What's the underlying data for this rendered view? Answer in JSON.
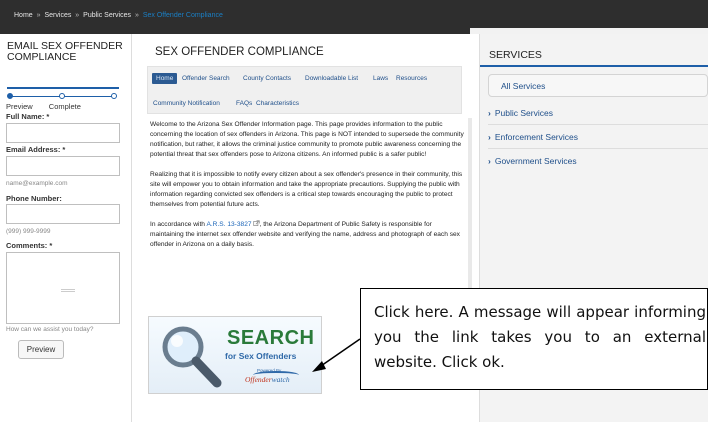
{
  "breadcrumb": {
    "items": [
      "Home",
      "Services",
      "Public Services"
    ],
    "separator": "»",
    "current": "Sex Offender Compliance"
  },
  "left_form": {
    "title": "EMAIL SEX OFFENDER COMPLIANCE",
    "steps": [
      "Preview",
      "Complete"
    ],
    "full_name_label": "Full Name: *",
    "email_label": "Email Address: *",
    "email_hint": "name@example.com",
    "phone_label": "Phone Number:",
    "phone_hint": "(999) 999-9999",
    "comments_label": "Comments: *",
    "comments_hint": "How can we assist you today?",
    "preview_button": "Preview"
  },
  "main": {
    "title": "SEX OFFENDER COMPLIANCE",
    "tabs": [
      "Home",
      "Offender Search",
      "County Contacts",
      "Downloadable List",
      "Laws",
      "Resources",
      "Community Notification",
      "FAQs",
      "Characteristics"
    ],
    "paragraph1": "Welcome to the Arizona Sex Offender Information page. This page provides information to the public concerning the location of sex offenders in Arizona. This page is NOT intended to supersede the community notification, but rather, it allows the criminal justice community to promote public awareness concerning the potential threat that sex offenders pose to Arizona citizens. An informed public is a safer public!",
    "paragraph2": "Realizing that it is impossible to notify every citizen about a sex offender's presence in their community, this site will empower you to obtain information and take the appropriate precautions. Supplying the public with information regarding convicted sex offenders is a critical step towards encouraging the public to protect themselves from potential future acts.",
    "paragraph3_before": "In accordance with ",
    "paragraph3_link": "A.R.S. 13-3827",
    "paragraph3_after": ", the Arizona Department of Public Safety is responsible for maintaining the internet sex offender website and verifying the name, address and photograph of each sex offender in Arizona on a daily basis.",
    "search_image": {
      "word": "SEARCH",
      "subtitle": "for Sex Offenders",
      "powered": "Powered By",
      "brand_a": "Offender",
      "brand_b": "watch"
    }
  },
  "services": {
    "title": "SERVICES",
    "all": "All Services",
    "items": [
      "Public Services",
      "Enforcement Services",
      "Government Services"
    ]
  },
  "callout": {
    "text": "Click here. A message will appear informing you the link takes you to an external website. Click ok."
  },
  "colors": {
    "topbar": "#2e2e2e",
    "accent_blue": "#1e5fa8",
    "active_tab": "#2b5a92",
    "search_green": "#2a7a3a",
    "brand_red": "#c0311a"
  },
  "icons": [
    "magnifier-icon",
    "chevron-right-icon",
    "external-link-icon"
  ]
}
